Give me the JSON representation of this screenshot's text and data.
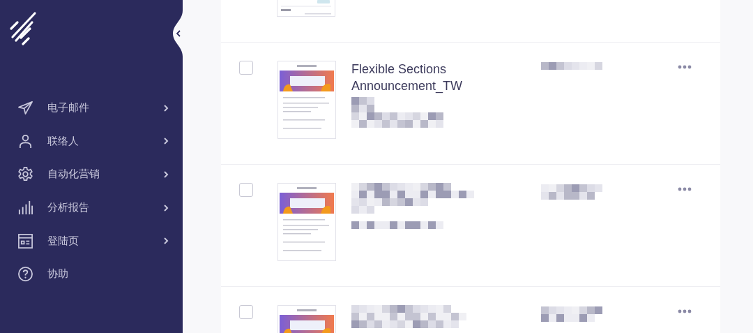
{
  "sidebar": {
    "items": [
      {
        "label": "电子邮件",
        "kind": "send",
        "has_submenu": true
      },
      {
        "label": "联络人",
        "kind": "person",
        "has_submenu": true
      },
      {
        "label": "自动化营销",
        "kind": "gear",
        "has_submenu": true
      },
      {
        "label": "分析报告",
        "kind": "bars",
        "has_submenu": true
      },
      {
        "label": "登陆页",
        "kind": "page",
        "has_submenu": true
      },
      {
        "label": "协助",
        "kind": "help",
        "has_submenu": false
      }
    ]
  },
  "rows": [
    {
      "kind": "tail"
    },
    {
      "kind": "full",
      "checked": false,
      "title": "Flexible Sections Announcement_TW"
    },
    {
      "kind": "full",
      "checked": false
    },
    {
      "kind": "full",
      "checked": false
    }
  ]
}
